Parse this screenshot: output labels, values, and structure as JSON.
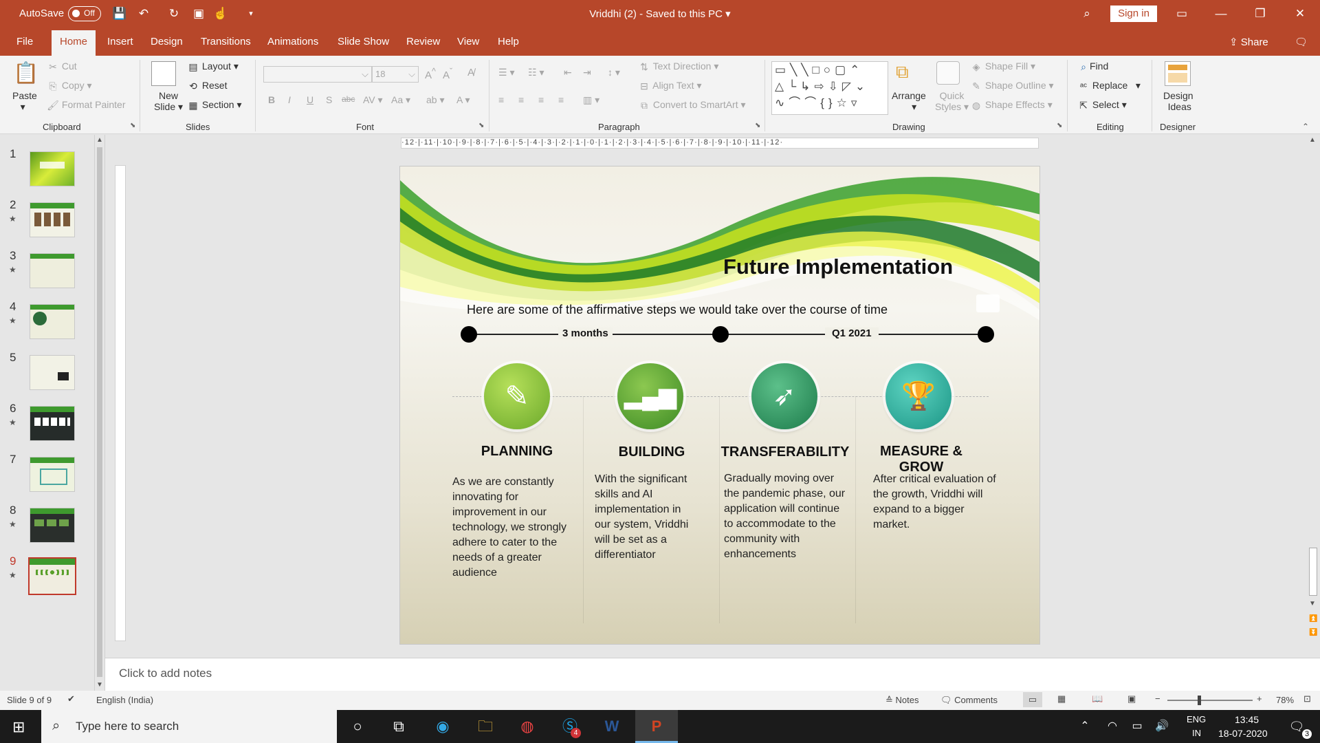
{
  "titlebar": {
    "autosave_label": "AutoSave",
    "autosave_state": "Off",
    "doc_title": "Vriddhi (2)  -  Saved to this PC",
    "sign_in": "Sign in"
  },
  "menu": {
    "tabs": [
      "File",
      "Home",
      "Insert",
      "Design",
      "Transitions",
      "Animations",
      "Slide Show",
      "Review",
      "View",
      "Help"
    ],
    "active": "Home",
    "share": "Share"
  },
  "ribbon": {
    "clipboard": {
      "paste": "Paste",
      "cut": "Cut",
      "copy": "Copy",
      "format_painter": "Format Painter",
      "label": "Clipboard"
    },
    "slides": {
      "new_slide_1": "New",
      "new_slide_2": "Slide",
      "layout": "Layout",
      "reset": "Reset",
      "section": "Section",
      "label": "Slides"
    },
    "font": {
      "size": "18",
      "label": "Font"
    },
    "paragraph": {
      "text_direction": "Text Direction",
      "align_text": "Align Text",
      "smartart": "Convert to SmartArt",
      "label": "Paragraph"
    },
    "drawing": {
      "arrange": "Arrange",
      "quick_styles_1": "Quick",
      "quick_styles_2": "Styles",
      "shape_fill": "Shape Fill",
      "shape_outline": "Shape Outline",
      "shape_effects": "Shape Effects",
      "label": "Drawing"
    },
    "editing": {
      "find": "Find",
      "replace": "Replace",
      "select": "Select",
      "label": "Editing"
    },
    "designer": {
      "ideas_1": "Design",
      "ideas_2": "Ideas",
      "label": "Designer"
    }
  },
  "thumbnails": [
    {
      "num": "1",
      "star": false
    },
    {
      "num": "2",
      "star": true
    },
    {
      "num": "3",
      "star": true
    },
    {
      "num": "4",
      "star": true
    },
    {
      "num": "5",
      "star": false
    },
    {
      "num": "6",
      "star": true
    },
    {
      "num": "7",
      "star": false
    },
    {
      "num": "8",
      "star": true
    },
    {
      "num": "9",
      "star": true
    }
  ],
  "ruler_labels": "·12·|·11·|·10·|·9·|·8·|·7·|·6·|·5·|·4·|·3·|·2·|·1·|·0·|·1·|·2·|·3·|·4·|·5·|·6·|·7·|·8·|·9·|·10·|·11·|·12·",
  "slide": {
    "title": "Future Implementation",
    "subtitle": "Here are some of the affirmative steps we would take over the course of time",
    "timeline": {
      "label1": "3 months",
      "label2": "Q1 2021"
    },
    "phases": [
      {
        "title": "PLANNING",
        "icon": "pencil-icon",
        "color": "#8cc63f",
        "text": "As we are constantly innovating for improvement in our technology, we strongly adhere to cater to the needs of a greater audience"
      },
      {
        "title": "BUILDING",
        "icon": "bar-chart-icon",
        "color": "#5aa02c",
        "text": "With the significant skills and AI implementation in our system, Vriddhi will be set as a differentiator"
      },
      {
        "title": "TRANSFERABILITY",
        "icon": "rocket-icon",
        "color": "#2e9d6b",
        "text": "Gradually moving over the pandemic phase, our application will continue to accommodate to the community with enhancements"
      },
      {
        "title": "MEASURE & GROW",
        "icon": "trophy-icon",
        "color": "#2bb3a0",
        "text": "After critical evaluation of the growth, Vriddhi will expand to a bigger market."
      }
    ]
  },
  "notes_placeholder": "Click to add notes",
  "status": {
    "slide": "Slide 9 of 9",
    "language": "English (India)",
    "notes": "Notes",
    "comments": "Comments",
    "zoom": "78%"
  },
  "taskbar": {
    "search_placeholder": "Type here to search",
    "lang1": "ENG",
    "lang2": "IN",
    "time": "13:45",
    "date": "18-07-2020",
    "badge": "4",
    "notif": "3"
  }
}
